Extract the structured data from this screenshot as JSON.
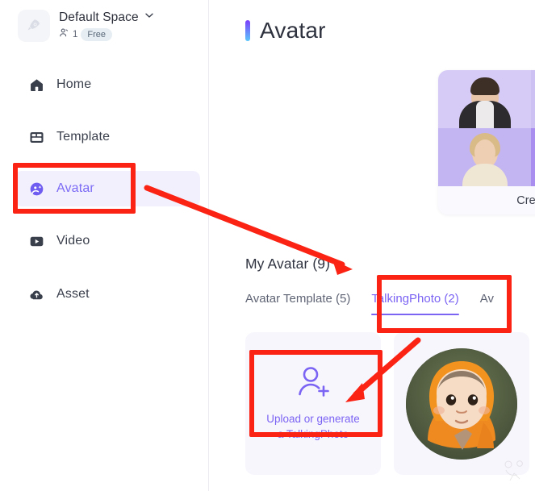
{
  "sidebar": {
    "workspace": {
      "logo_icon": "rocket-icon",
      "name": "Default Space",
      "chevron_icon": "chevron-down-icon",
      "members_icon": "members-icon",
      "member_count": "1",
      "plan_badge": "Free"
    },
    "items": [
      {
        "label": "Home",
        "icon": "home-icon",
        "active": false
      },
      {
        "label": "Template",
        "icon": "template-icon",
        "active": false
      },
      {
        "label": "Avatar",
        "icon": "avatar-icon",
        "active": true
      },
      {
        "label": "Video",
        "icon": "video-icon",
        "active": false
      },
      {
        "label": "Asset",
        "icon": "asset-cloud-icon",
        "active": false
      }
    ]
  },
  "main": {
    "page_title": "Avatar",
    "hero_card": {
      "footer_label": "Creat",
      "tile_count": 4
    },
    "section_title": "My Avatar (9)",
    "tabs": [
      {
        "label": "Avatar Template (5)",
        "active": false
      },
      {
        "label": "TalkingPhoto (2)",
        "active": true
      },
      {
        "label": "Av",
        "active": false
      }
    ],
    "cards": [
      {
        "type": "upload",
        "icon": "user-plus-icon",
        "label_line1": "Upload or generate",
        "label_line2": "a TalkingPhoto"
      },
      {
        "type": "photo",
        "alt": "baby-in-orange-hood-avatar"
      }
    ],
    "watermark_icon": "watermark-icon"
  },
  "colors": {
    "accent_purple": "#7b63f3",
    "annotation_red": "#fa2314",
    "active_nav_bg": "#f3f0fd",
    "card_bg": "#f8f6fd",
    "plan_badge_bg": "#e6eef4"
  },
  "annotations": {
    "boxes": [
      {
        "name": "sidebar-avatar-highlight"
      },
      {
        "name": "talkingphoto-tab-highlight"
      },
      {
        "name": "upload-card-highlight"
      }
    ],
    "arrows": [
      {
        "name": "arrow-avatar-to-my-avatar"
      },
      {
        "name": "arrow-tab-to-upload-card"
      }
    ]
  }
}
